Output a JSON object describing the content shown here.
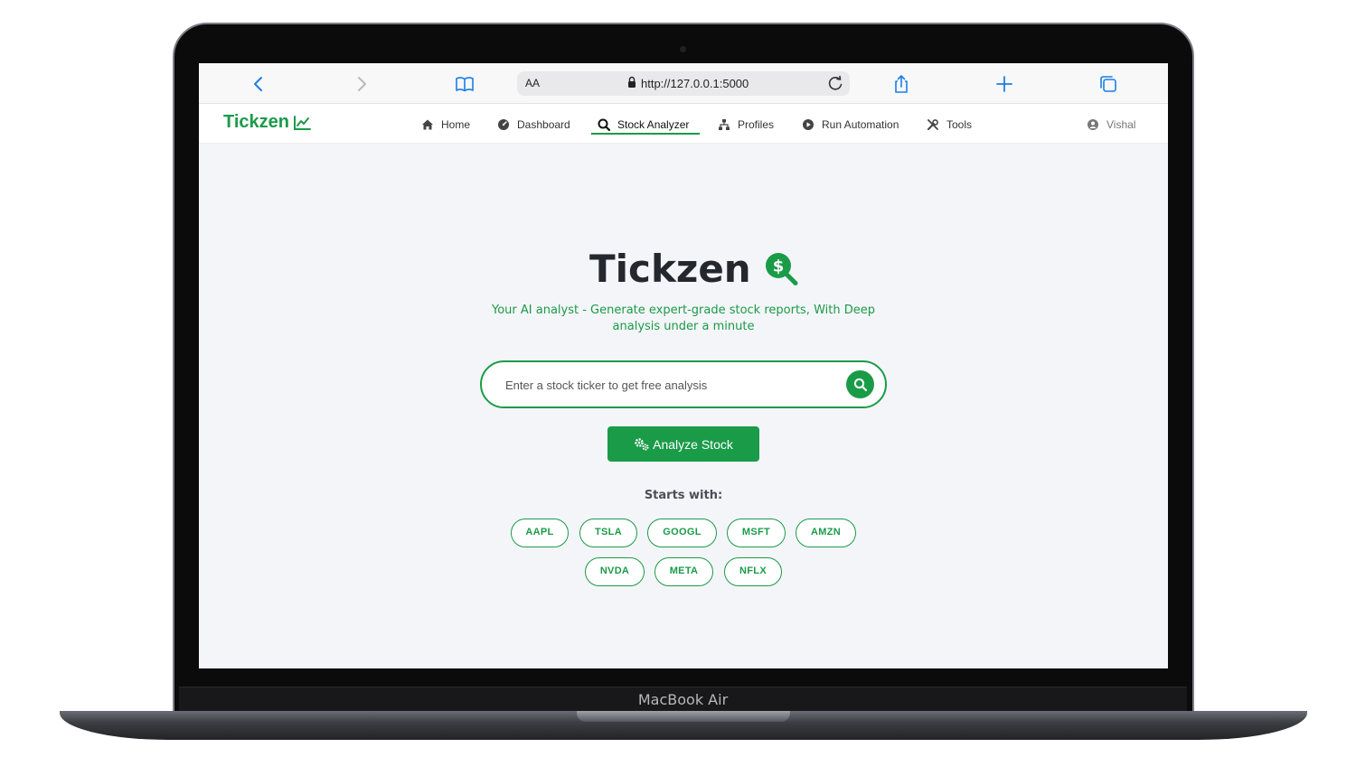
{
  "device": {
    "label": "MacBook Air"
  },
  "browser": {
    "text_size_label": "AA",
    "url": "http://127.0.0.1:5000"
  },
  "nav": {
    "brand": "Tickzen",
    "items": [
      {
        "label": "Home",
        "icon": "home-icon"
      },
      {
        "label": "Dashboard",
        "icon": "dashboard-icon"
      },
      {
        "label": "Stock Analyzer",
        "icon": "search-dollar-icon",
        "active": true
      },
      {
        "label": "Profiles",
        "icon": "sitemap-icon"
      },
      {
        "label": "Run Automation",
        "icon": "play-circle-icon"
      },
      {
        "label": "Tools",
        "icon": "tools-icon"
      }
    ],
    "user": "Vishal"
  },
  "hero": {
    "title": "Tickzen",
    "tagline": "Your AI analyst - Generate expert-grade stock reports, With Deep analysis under a minute"
  },
  "search": {
    "placeholder": "Enter a stock ticker to get free analysis",
    "value": ""
  },
  "analyze_button": "Analyze Stock",
  "starts_with": {
    "label": "Starts with:",
    "tickers": [
      "AAPL",
      "TSLA",
      "GOOGL",
      "MSFT",
      "AMZN",
      "NVDA",
      "META",
      "NFLX"
    ]
  },
  "colors": {
    "accent": "#1a9b48",
    "page_bg": "#f4f5f8",
    "title": "#24282e"
  }
}
